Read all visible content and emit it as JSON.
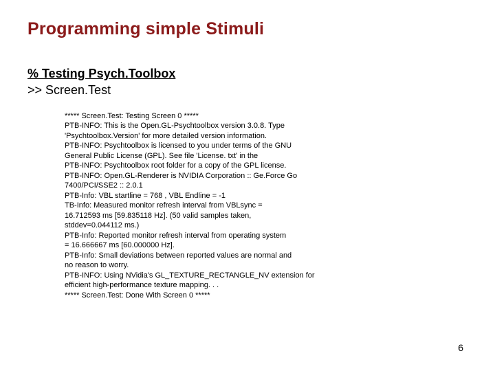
{
  "title": "Programming simple Stimuli",
  "cmd": {
    "line1": "% Testing Psych.Toolbox",
    "line2": ">> Screen.Test"
  },
  "output": {
    "l0": "***** Screen.Test: Testing Screen 0 *****",
    "l1": "PTB-INFO: This is the Open.GL-Psychtoolbox version 3.0.8. Type",
    "l2": "'Psychtoolbox.Version' for more detailed version information.",
    "l3": "PTB-INFO: Psychtoolbox is licensed to you under terms of the GNU",
    "l4": "General Public License (GPL). See file 'License. txt' in the",
    "l5": "PTB-INFO: Psychtoolbox root folder for a copy of the GPL license.",
    "l6": "PTB-INFO: Open.GL-Renderer is NVIDIA Corporation :: Ge.Force Go",
    "l7": "7400/PCI/SSE2 :: 2.0.1",
    "l8": "PTB-Info: VBL startline = 768 , VBL Endline = -1",
    "l9": " TB-Info: Measured monitor refresh interval from VBLsync =",
    "l10": "16.712593 ms [59.835118 Hz]. (50 valid samples taken,",
    "l11": "stddev=0.044112 ms.)",
    "l12": "PTB-Info: Reported monitor refresh interval from operating system",
    "l13": "= 16.666667 ms [60.000000 Hz].",
    "l14": "PTB-Info: Small deviations between reported values are normal and",
    "l15": "no reason to worry.",
    "l16": "PTB-INFO: Using NVidia's GL_TEXTURE_RECTANGLE_NV extension for",
    "l17": "efficient high-performance texture mapping. . .",
    "l18": "***** Screen.Test: Done With Screen 0 *****"
  },
  "pagenum": "6"
}
